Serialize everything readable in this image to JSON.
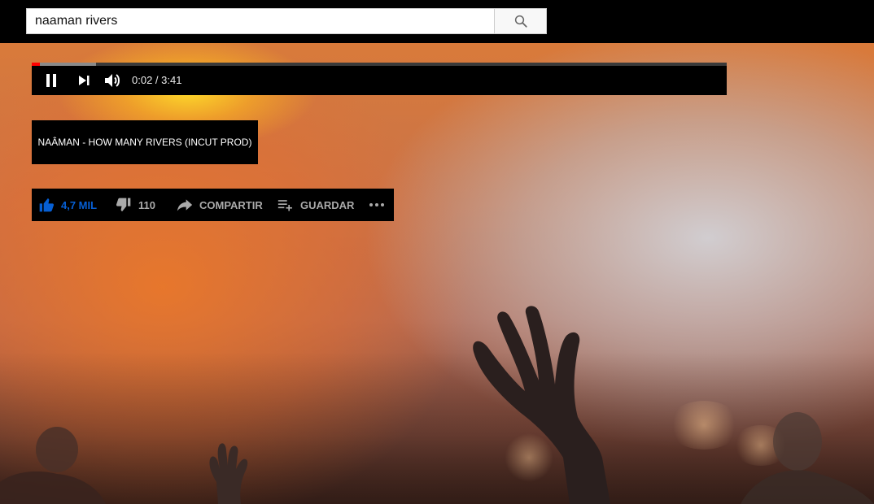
{
  "search": {
    "value": "naaman rivers",
    "icon": "search-icon"
  },
  "player": {
    "time_current": "0:02",
    "time_total": "3:41",
    "time_display": "0:02 / 3:41",
    "progress_fraction": 0.009,
    "buffered_fraction": 0.092,
    "controls": [
      "pause-icon",
      "next-icon",
      "volume-icon"
    ],
    "played_color": "#ff0000"
  },
  "video": {
    "title": "NAÂMAN - HOW MANY RIVERS (INCUT PROD)"
  },
  "actions": {
    "like_count": "4,7 MIL",
    "dislike_count": "110",
    "share_label": "COMPARTIR",
    "save_label": "GUARDAR",
    "like_color": "#065fd4",
    "text_color": "#aaaaaa"
  }
}
